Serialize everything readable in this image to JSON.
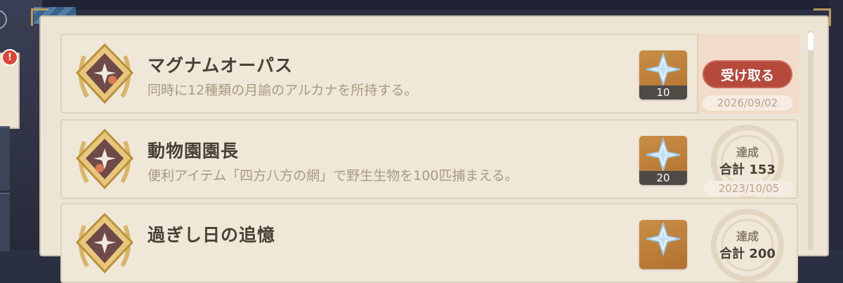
{
  "colors": {
    "accent": "#b5493c",
    "panel": "#ece5d6",
    "gold": "#d9b56a"
  },
  "alert_badge": "!",
  "achievements": [
    {
      "title": "マグナムオーパス",
      "description": "同時に12種類の月諭のアルカナを所持する。",
      "reward_icon": "primogem-icon",
      "reward_qty": "10",
      "status": "claimable",
      "claim_label": "受け取る",
      "date": "2026/09/02"
    },
    {
      "title": "動物園園長",
      "description": "便利アイテム「四方八方の網」で野生生物を100匹捕まえる。",
      "reward_icon": "primogem-icon",
      "reward_qty": "20",
      "status": "completed",
      "achieved_label": "達成",
      "total": "合計 153",
      "date": "2023/10/05"
    },
    {
      "title": "過ぎし日の追憶",
      "reward_icon": "primogem-icon",
      "status": "completed",
      "achieved_label": "達成",
      "total": "合計 200"
    }
  ]
}
